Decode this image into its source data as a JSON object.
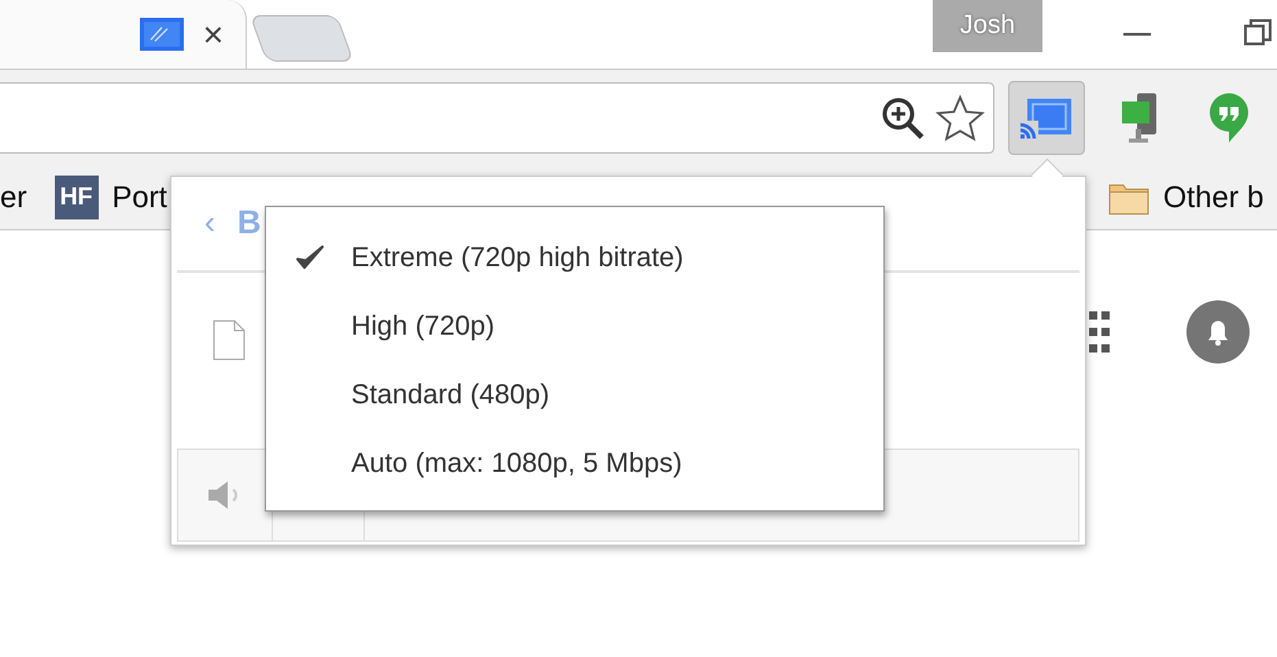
{
  "tabs": [
    {
      "selected": true,
      "close": "×"
    },
    {
      "selected": false
    }
  ],
  "profile": "Josh",
  "bookmarks": [
    {
      "kind": "plain",
      "label": "er"
    },
    {
      "kind": "hf",
      "badge": "HF",
      "label": "Port"
    },
    {
      "kind": "folder",
      "label": "Other b"
    }
  ],
  "popup": {
    "back": {
      "arrow": "‹",
      "label": "B"
    }
  },
  "quality_menu": [
    {
      "label": "Extreme (720p high bitrate)",
      "selected": true
    },
    {
      "label": "High (720p)",
      "selected": false
    },
    {
      "label": "Standard (480p)",
      "selected": false
    },
    {
      "label": "Auto (max: 1080p, 5 Mbps)",
      "selected": false
    }
  ]
}
